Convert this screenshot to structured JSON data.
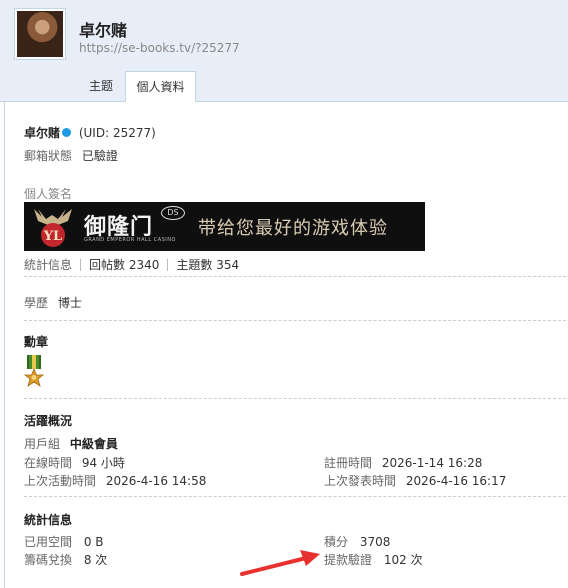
{
  "header": {
    "username": "卓尔赌",
    "profile_url": "https://se-books.tv/?25277",
    "tabs": {
      "topics": "主题",
      "profile": "個人資料"
    }
  },
  "profile": {
    "name": "卓尔赌",
    "uid": "(UID: 25277)",
    "email_status_label": "郵箱狀態",
    "email_status_value": "已驗證",
    "signature_label": "個人簽名",
    "signature_banner": {
      "brand": "御隆门",
      "brand_sub": "GRAND EMPEROR HALL CASINO",
      "badge": "DS",
      "slogan": "带给您最好的游戏体验"
    },
    "stats_label": "統計信息",
    "reply_count": "回帖數 2340",
    "thread_count": "主題數 354",
    "education_label": "學歷",
    "education_value": "博士"
  },
  "medals": {
    "title": "勳章",
    "icon": "medal-icon"
  },
  "activity": {
    "title": "活躍概況",
    "user_group_label": "用戶組",
    "user_group_value": "中級會員",
    "online_time_label": "在線時間",
    "online_time_value": "94 小時",
    "register_time_label": "註冊時間",
    "register_time_value": "2026-1-14 16:28",
    "last_active_label": "上次活動時間",
    "last_active_value": "2026-4-16 14:58",
    "last_post_label": "上次發表時間",
    "last_post_value": "2026-4-16 16:17"
  },
  "statistics": {
    "title": "統計信息",
    "used_space_label": "已用空間",
    "used_space_value": "0 B",
    "credits_label": "積分",
    "credits_value": "3708",
    "chips_label": "籌碼兌換",
    "chips_value": "8 次",
    "withdraw_label": "提款驗證",
    "withdraw_value": "102 次"
  },
  "colors": {
    "accent_blue": "#1e9be6",
    "annotation_red": "#e8312f",
    "header_bg": "#e8eef7"
  }
}
